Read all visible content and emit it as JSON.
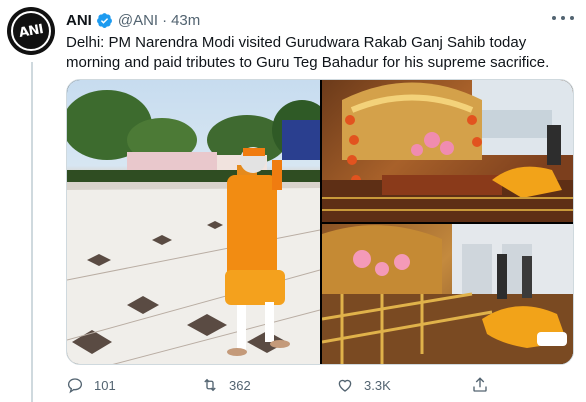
{
  "tweet": {
    "author_name": "ANI",
    "avatar_text": "ANI",
    "handle": "@ANI",
    "separator": "·",
    "time": "43m",
    "text": "Delhi: PM Narendra Modi visited Gurudwara Rakab Ganj Sahib today morning and paid tributes to Guru Teg Bahadur for his supreme sacrifice."
  },
  "actions": {
    "replies": "101",
    "retweets": "362",
    "likes": "3.3K"
  },
  "colors": {
    "verified": "#1d9bf0",
    "secondary_text": "#536471",
    "border": "#cfd9de"
  },
  "icons": [
    "verified-badge-icon",
    "more-icon",
    "reply-icon",
    "retweet-icon",
    "like-icon",
    "share-icon"
  ]
}
